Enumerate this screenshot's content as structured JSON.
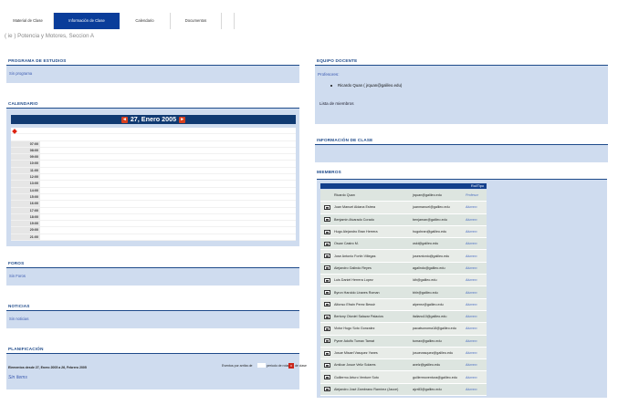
{
  "tabs": [
    {
      "label": "Material de Clase"
    },
    {
      "label": "Información de Clase"
    },
    {
      "label": "Calendario"
    },
    {
      "label": "Documentos"
    },
    {
      "label": ""
    }
  ],
  "course_title": "( ie ) Potencia y Motores, Seccion A",
  "left": {
    "programa": {
      "title": "PROGRAMA DE ESTUDIOS",
      "link": "Sin programa"
    },
    "calendario": {
      "title": "CALENDARIO",
      "date": "27, Enero 2005",
      "prev": "◄",
      "next": "►",
      "hours": [
        "",
        "07:00",
        "08:00",
        "09:00",
        "10:00",
        "11:00",
        "12:00",
        "13:00",
        "14:00",
        "15:00",
        "16:00",
        "17:00",
        "18:00",
        "19:00",
        "20:00",
        "21:00",
        ""
      ]
    },
    "foros": {
      "title": "FOROS",
      "link": "Sin Foros"
    },
    "noticias": {
      "title": "NOTICIAS",
      "link": "Sin noticias"
    },
    "planificacion": {
      "title": "PLANIFICACIÓN",
      "range": "Elementos desde 27, Enero 2005 a 26, Febrero 2005",
      "events_a": "Eventos por arriba de",
      "events_b": "periodo de rotación de clase",
      "close": "x",
      "empty": "Sin ítems"
    }
  },
  "right": {
    "equipo": {
      "title": "EQUIPO DOCENTE",
      "profesores_label": "Profesores:",
      "professor": "Ricardo Quan  ( jrquan@galileo.edu)",
      "lista": "Lista de miembros"
    },
    "info": {
      "title": "INFORMACIÓN DE CLASE"
    },
    "miembros": {
      "title": "MIEMBROS",
      "col_role": "Rol/Tipo",
      "rows": [
        {
          "name": "Ricardo Quan",
          "email": "jrquan@galileo.edu",
          "role": "Profesor",
          "icon": false
        },
        {
          "name": "Juan Manuel Aldana Estrea",
          "email": "juanmanuel@galileo.edu",
          "role": "Alumno",
          "icon": true
        },
        {
          "name": "Benjamin Alvarado Corado",
          "email": "benjaman@galileo.edu",
          "role": "Alumno",
          "icon": true
        },
        {
          "name": "Hugo Alejandro Bran Herrera",
          "email": "hugobran@galileo.edu",
          "role": "Alumno",
          "icon": true
        },
        {
          "name": "Oscar Castro M.",
          "email": "oski@galileo.edu",
          "role": "Alumno",
          "icon": true
        },
        {
          "name": "Jose Antonio Fortin Villegas",
          "email": "josesntonio@galileo.edu",
          "role": "Alumno",
          "icon": true
        },
        {
          "name": "Alejandro Galindo Reyes",
          "email": "agalindo@galileo.edu",
          "role": "Alumno",
          "icon": true
        },
        {
          "name": "Luis Daniel Herrera Lopez",
          "email": "ldh@galileo.edu",
          "role": "Alumno",
          "icon": true
        },
        {
          "name": "Byron Haroldo Linares Roman",
          "email": "bhlr@galileo.edu",
          "role": "Alumno",
          "icon": true
        },
        {
          "name": "Alfonso Efrain Perez Bessir",
          "email": "alperez@galileo.edu",
          "role": "Alumno",
          "icon": true
        },
        {
          "name": "Bertony Otoniel Salazar Palacios",
          "email": "italiano10@galileo.edu",
          "role": "Alumno",
          "icon": true
        },
        {
          "name": "Victor Hugo Soto Gonzalez",
          "email": "pacatsonoma18@galileo.edu",
          "role": "Alumno",
          "icon": true
        },
        {
          "name": "Pyner Adolfo Tumax Tamat",
          "email": "tumax@galileo.edu",
          "role": "Alumno",
          "icon": true
        },
        {
          "name": "Josue Misael Vasquez Yanes",
          "email": "josuevasquez@galileo.edu",
          "role": "Alumno",
          "icon": true
        },
        {
          "name": "Amilcar Josue Veliz Solares",
          "email": "avelz@galileo.edu",
          "role": "Alumno",
          "icon": true
        },
        {
          "name": "Guillermo Arturo Venture Soto",
          "email": "guillermoventura@galileo.edu",
          "role": "Alumno",
          "icon": true
        },
        {
          "name": "Alejandro José Zambrano Ramírez (Jacce)",
          "email": "ajzr83@galileo.edu",
          "role": "Alumno",
          "icon": true
        }
      ]
    }
  }
}
